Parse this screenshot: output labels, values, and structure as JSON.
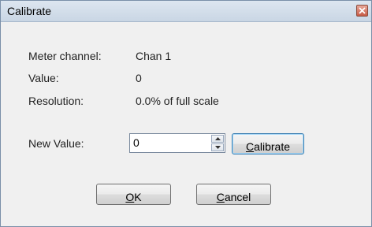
{
  "window": {
    "title": "Calibrate"
  },
  "info": {
    "meter_channel_label": "Meter channel:",
    "meter_channel_value": "Chan 1",
    "value_label": "Value:",
    "value_value": "0",
    "resolution_label": "Resolution:",
    "resolution_value": "0.0% of full scale"
  },
  "new_value": {
    "label": "New Value:",
    "value": "0"
  },
  "buttons": {
    "calibrate_mnemonic": "C",
    "calibrate_rest": "alibrate",
    "ok_mnemonic": "O",
    "ok_rest": "K",
    "cancel_mnemonic": "C",
    "cancel_rest": "ancel"
  },
  "icons": {
    "close": "close-icon",
    "up": "spin-up-icon",
    "down": "spin-down-icon"
  },
  "colors": {
    "focus_border": "#3c7fb1",
    "close_button": "#c75a45"
  }
}
